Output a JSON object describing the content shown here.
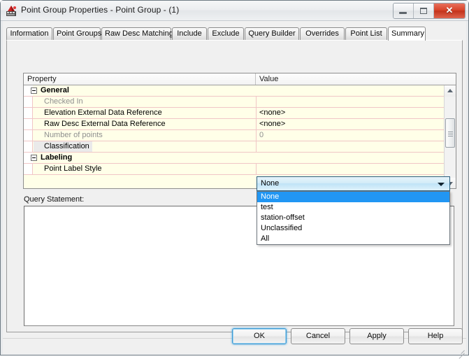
{
  "window": {
    "title": "Point Group Properties - Point Group - (1)",
    "icon": "point-group-icon",
    "minimize_label": "Minimize",
    "maximize_label": "Maximize",
    "close_label": "✕"
  },
  "tabs": [
    {
      "label": "Information",
      "active": false
    },
    {
      "label": "Point Groups",
      "active": false
    },
    {
      "label": "Raw Desc Matching",
      "active": false
    },
    {
      "label": "Include",
      "active": false
    },
    {
      "label": "Exclude",
      "active": false
    },
    {
      "label": "Query Builder",
      "active": false
    },
    {
      "label": "Overrides",
      "active": false
    },
    {
      "label": "Point List",
      "active": false
    },
    {
      "label": "Summary",
      "active": true
    }
  ],
  "grid": {
    "headers": {
      "property": "Property",
      "value": "Value"
    },
    "rows": [
      {
        "type": "category",
        "name": "General",
        "value": ""
      },
      {
        "type": "property",
        "name": "Checked In",
        "value": "",
        "dim": true
      },
      {
        "type": "property",
        "name": "Elevation External Data Reference",
        "value": "<none>",
        "dim": false
      },
      {
        "type": "property",
        "name": "Raw Desc External Data Reference",
        "value": "<none>",
        "dim": false
      },
      {
        "type": "property",
        "name": "Number of points",
        "value": "0",
        "dim": true
      },
      {
        "type": "property",
        "name": "Classification",
        "value": "",
        "dim": false,
        "selected": true
      },
      {
        "type": "category",
        "name": "Labeling",
        "value": ""
      },
      {
        "type": "property",
        "name": "Point Label Style",
        "value": "",
        "dim": false
      }
    ]
  },
  "combo": {
    "value": "None",
    "options": [
      {
        "label": "None",
        "highlighted": true
      },
      {
        "label": "test",
        "highlighted": false
      },
      {
        "label": "station-offset",
        "highlighted": false
      },
      {
        "label": "Unclassified",
        "highlighted": false
      },
      {
        "label": "All",
        "highlighted": false
      }
    ]
  },
  "query": {
    "label": "Query Statement:",
    "value": "",
    "placeholder": ""
  },
  "footer": {
    "buttons": [
      {
        "label": "OK",
        "default": true
      },
      {
        "label": "Cancel",
        "default": false
      },
      {
        "label": "Apply",
        "default": false
      },
      {
        "label": "Help",
        "default": false
      }
    ]
  },
  "colors": {
    "grid_background": "#ffffe8",
    "row_separator": "#f0c6c6",
    "highlight": "#2196f3",
    "close_button": "#c2331c",
    "default_button_focus": "#3c99d4"
  }
}
